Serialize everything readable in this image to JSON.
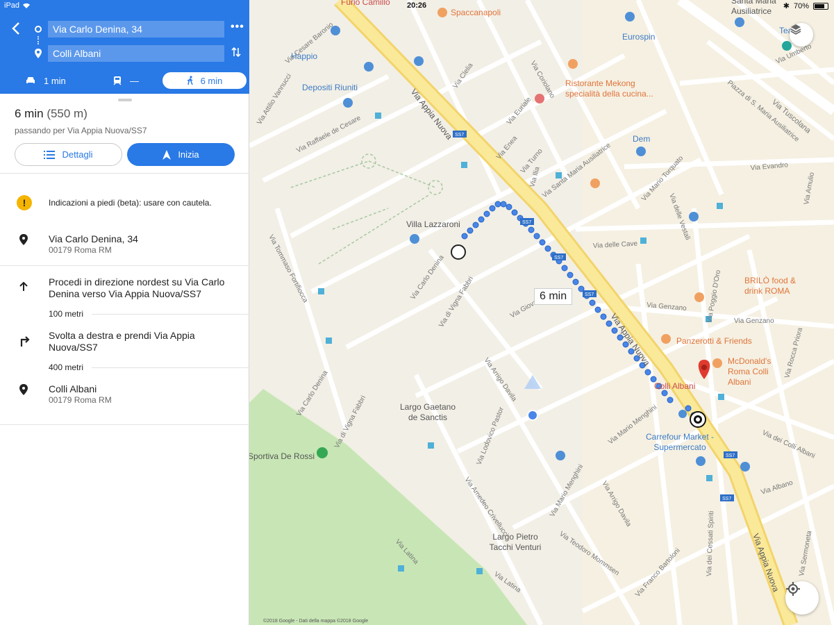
{
  "status_bar": {
    "device": "iPad",
    "time": "20:26",
    "battery": "70%"
  },
  "header": {
    "origin": "Via Carlo Denina, 34",
    "destination": "Colli Albani",
    "modes": [
      {
        "name": "car",
        "label": "1 min"
      },
      {
        "name": "transit",
        "label": "—"
      },
      {
        "name": "walk",
        "label": "6 min",
        "selected": true
      }
    ]
  },
  "summary": {
    "time": "6 min",
    "distance": "(550 m)",
    "via": "passando per Via Appia Nuova/SS7",
    "details_label": "Dettagli",
    "start_label": "Inizia"
  },
  "warning": "Indicazioni a piedi (beta): usare con cautela.",
  "steps": [
    {
      "icon": "pin-icon",
      "title": "Via Carlo Denina, 34",
      "subtitle": "00179 Roma RM"
    },
    {
      "icon": "arrow-up-icon",
      "title": "Procedi in direzione nordest su Via Carlo Denina verso Via Appia Nuova/SS7",
      "distance": "100 metri"
    },
    {
      "icon": "turn-right-icon",
      "title": "Svolta a destra e prendi Via Appia Nuova/SS7",
      "distance": "400 metri"
    },
    {
      "icon": "pin-icon",
      "title": "Colli Albani",
      "subtitle": "00179 Roma RM"
    }
  ],
  "map": {
    "route_time": "6 min",
    "attribution": "©2018 Google - Dati della mappa ©2018 Google",
    "pois": [
      {
        "id": "furio-camillo",
        "label": "Furio Camillo",
        "style": "red"
      },
      {
        "id": "spaccanapoli",
        "label": "Spaccanapoli",
        "style": "orange"
      },
      {
        "id": "santa-maria",
        "label": "Santa Maria Ausiliatrice",
        "style": "gray"
      },
      {
        "id": "happio",
        "label": "Happio",
        "style": "blue"
      },
      {
        "id": "eurospin",
        "label": "Eurospin",
        "style": "blue"
      },
      {
        "id": "depositi",
        "label": "Depositi Riuniti",
        "style": "blue"
      },
      {
        "id": "mekong",
        "label": "Ristorante Mekong specialità della cucina...",
        "style": "orange"
      },
      {
        "id": "dem",
        "label": "Dem",
        "style": "blue"
      },
      {
        "id": "villa-lazzaroni",
        "label": "Villa Lazzaroni",
        "style": "gray"
      },
      {
        "id": "brilo",
        "label": "BRILÒ food & drink ROMA",
        "style": "orange"
      },
      {
        "id": "panzerotti",
        "label": "Panzerotti & Friends",
        "style": "orange"
      },
      {
        "id": "mcdonalds",
        "label": "McDonald's Roma Colli Albani",
        "style": "orange"
      },
      {
        "id": "colli-albani",
        "label": "Colli Albani",
        "style": "red"
      },
      {
        "id": "carrefour",
        "label": "Carrefour Market - Supermercato",
        "style": "blue"
      },
      {
        "id": "largo-gaetano",
        "label": "Largo Gaetano de Sanctis",
        "style": "gray"
      },
      {
        "id": "largo-pietro",
        "label": "Largo Pietro Tacchi Venturi",
        "style": "gray"
      },
      {
        "id": "sportiva",
        "label": "Sportiva De Rossi",
        "style": "gray"
      },
      {
        "id": "tea",
        "label": "Tea",
        "style": "blue"
      }
    ],
    "streets": [
      "Via Appia Nuova",
      "Via Carlo Denina",
      "Via di Vigna Fabbri",
      "Via Giovanni",
      "Via Tuscolana",
      "Via Tommaso Fortifiocca",
      "Via Attilio Vannucci",
      "Via Raffaele de Cesare",
      "Via Cesare Baronio",
      "Via Clelia",
      "Via Euriale",
      "Via Enea",
      "Via Turno",
      "Via Ilia",
      "Via Coriolano",
      "Via Santa Maria Ausiliatrice",
      "Via Mario Torquato",
      "Via delle Vestali",
      "Via delle Cave",
      "Via Evandro",
      "Via Amulio",
      "Via Genzano",
      "Via Rocca Priora",
      "Via Poggio D'Oro",
      "Via dei Colli Albani",
      "Via Albano",
      "Via Sermoneta",
      "Via dei Cessati Spiriti",
      "Via Arrigo Davila",
      "Via Mario Menghini",
      "Via Amedeo Crivellucci",
      "Via Lodovico Pastor",
      "Via Latina",
      "Via Teodoro Mommsen",
      "Via Franco Bartoloni",
      "Via Umberto",
      "Piazza di S. Maria Ausiliatrice"
    ],
    "road_badges": [
      "SS7"
    ]
  }
}
